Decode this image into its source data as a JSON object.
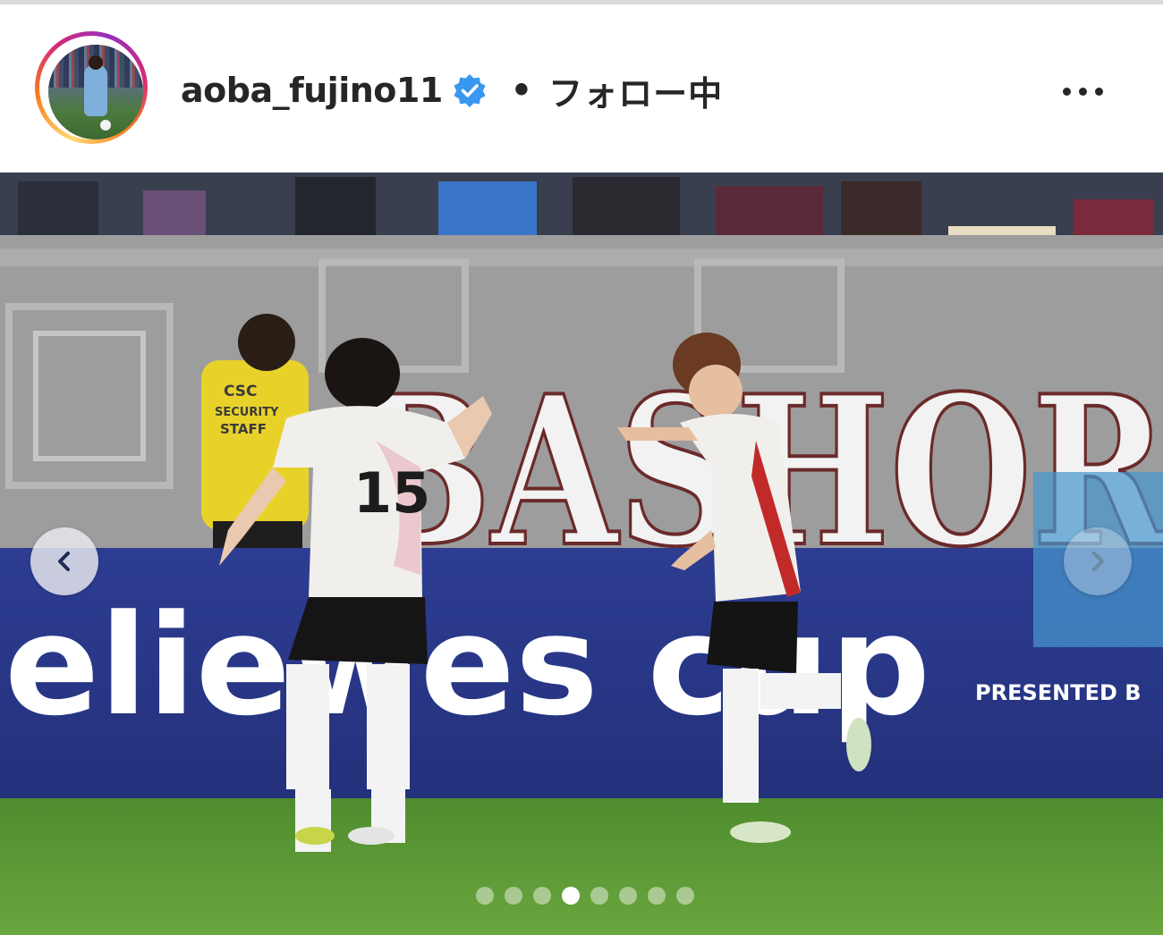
{
  "post": {
    "username": "aoba_fujino11",
    "separator": "•",
    "follow_status": "フォロー中",
    "more_icon": "more-horizontal-icon",
    "verified_icon": "verified-badge-icon"
  },
  "media": {
    "jersey_number": "15",
    "banner_text": "BASHOR",
    "board_text": "eliewes cup",
    "board_subtext": "PRESENTED B",
    "staff_vest_line1": "CSC",
    "staff_vest_line2": "SECURITY",
    "staff_vest_line3": "STAFF",
    "prev_icon": "chevron-left-icon",
    "next_icon": "chevron-right-icon",
    "carousel_total": 8,
    "carousel_active_index": 3
  },
  "colors": {
    "verified_blue": "#3897f0",
    "text": "#262626",
    "board_blue": "#2a3a8c",
    "field_green": "#5e9a36"
  }
}
